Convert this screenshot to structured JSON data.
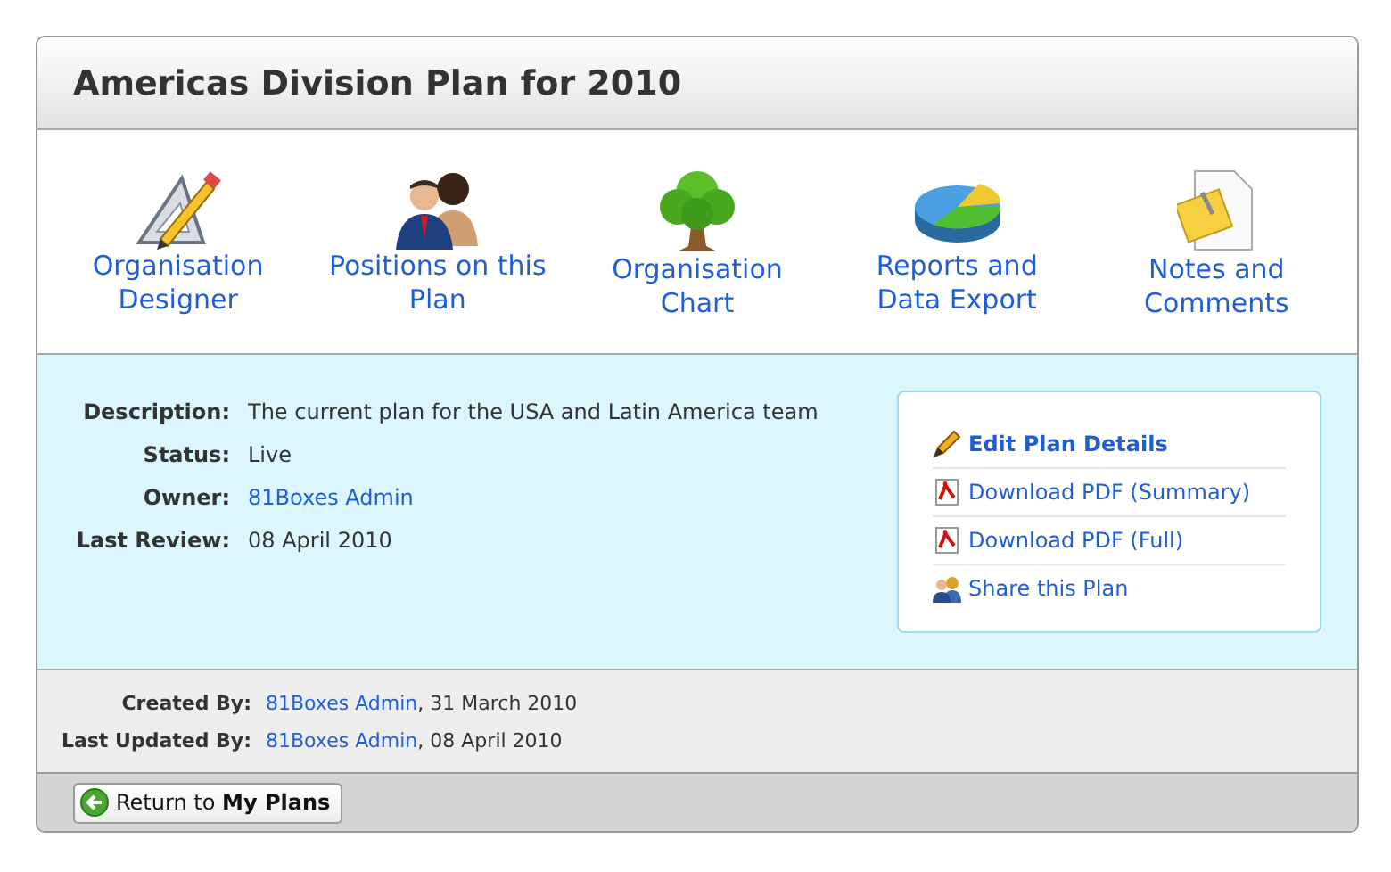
{
  "title": "Americas Division Plan for 2010",
  "tools": [
    {
      "kind": "designer",
      "label": "Organisation Designer"
    },
    {
      "kind": "people",
      "label": "Positions on this Plan"
    },
    {
      "kind": "tree",
      "label": "Organisation Chart"
    },
    {
      "kind": "chart",
      "label": "Reports and Data Export"
    },
    {
      "kind": "notes",
      "label": "Notes and Comments"
    }
  ],
  "details": [
    {
      "label": "Description:",
      "value": "The current plan for the USA and Latin America team",
      "kind": "text"
    },
    {
      "label": "Status:",
      "value": "Live",
      "kind": "text"
    },
    {
      "label": "Owner:",
      "value": "81Boxes Admin",
      "kind": "link"
    },
    {
      "label": "Last Review:",
      "value": "08 April 2010",
      "kind": "text"
    }
  ],
  "actions": [
    {
      "kind": "edit",
      "label": "Edit Plan Details"
    },
    {
      "kind": "pdf",
      "label": "Download PDF (Summary)"
    },
    {
      "kind": "pdf",
      "label": "Download PDF (Full)"
    },
    {
      "kind": "share",
      "label": "Share this Plan"
    }
  ],
  "audit": [
    {
      "label": "Created By:",
      "user": "81Boxes Admin",
      "date": ", 31 March 2010"
    },
    {
      "label": "Last Updated By:",
      "user": "81Boxes Admin",
      "date": ", 08 April 2010"
    }
  ],
  "return_button": "Return to **My Plans**"
}
